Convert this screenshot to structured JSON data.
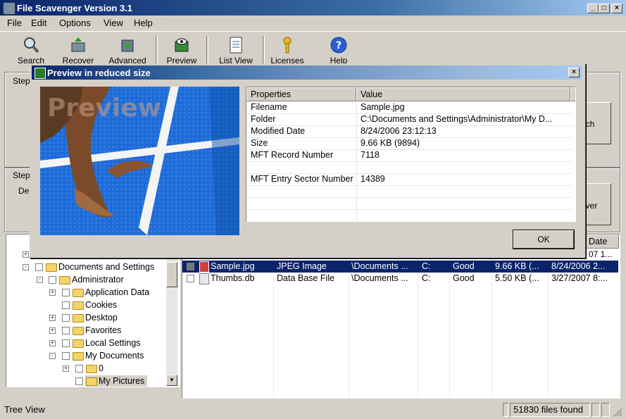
{
  "window": {
    "title": "File Scavenger Version 3.1"
  },
  "menu": [
    "File",
    "Edit",
    "Options",
    "View",
    "Help"
  ],
  "toolbar": {
    "search": "Search",
    "recover": "Recover",
    "advanced": "Advanced",
    "preview": "Preview",
    "list_view": "List View",
    "licenses": "Licenses",
    "help": "Help"
  },
  "steps": {
    "step1": "Step",
    "step2": "Step",
    "step2_partial": "De",
    "search_partial": "arch",
    "recover_partial": "over"
  },
  "tree": {
    "items": [
      {
        "label": "Documents and Settings",
        "sign": "-"
      },
      {
        "label": "Administrator",
        "sign": "-"
      },
      {
        "label": "Application Data",
        "sign": "+"
      },
      {
        "label": "Cookies",
        "sign": ""
      },
      {
        "label": "Desktop",
        "sign": "+"
      },
      {
        "label": "Favorites",
        "sign": "+"
      },
      {
        "label": "Local Settings",
        "sign": "+"
      },
      {
        "label": "My Documents",
        "sign": "-"
      },
      {
        "label": "0",
        "sign": "+"
      },
      {
        "label": "My Pictures",
        "sign": ""
      }
    ]
  },
  "list": {
    "header_date": "Date",
    "partial_top": "07 1...",
    "rows": [
      {
        "name": "Sample.jpg",
        "type": "JPEG Image",
        "folder": "\\Documents ...",
        "drive": "C:",
        "state": "Good",
        "size": "9.66 KB (...",
        "date": "8/24/2006 2..."
      },
      {
        "name": "Thumbs.db",
        "type": "Data Base File",
        "folder": "\\Documents ...",
        "drive": "C:",
        "state": "Good",
        "size": "5.50 KB (...",
        "date": "3/27/2007 8:..."
      }
    ]
  },
  "status": {
    "left": "Tree View",
    "count": "51830 files found"
  },
  "dialog": {
    "title": "Preview in reduced size",
    "watermark": "Preview",
    "col_properties": "Properties",
    "col_value": "Value",
    "props": [
      {
        "k": "Filename",
        "v": "Sample.jpg"
      },
      {
        "k": "Folder",
        "v": "C:\\Documents and Settings\\Administrator\\My D..."
      },
      {
        "k": "Modified Date",
        "v": "8/24/2006 23:12:13"
      },
      {
        "k": "Size",
        "v": "9.66 KB (9894)"
      },
      {
        "k": "MFT Record Number",
        "v": "7118"
      },
      {
        "k": "",
        "v": ""
      },
      {
        "k": "MFT Entry Sector Number",
        "v": "14389"
      },
      {
        "k": "",
        "v": ""
      },
      {
        "k": "",
        "v": ""
      },
      {
        "k": "",
        "v": ""
      }
    ],
    "ok": "OK"
  }
}
